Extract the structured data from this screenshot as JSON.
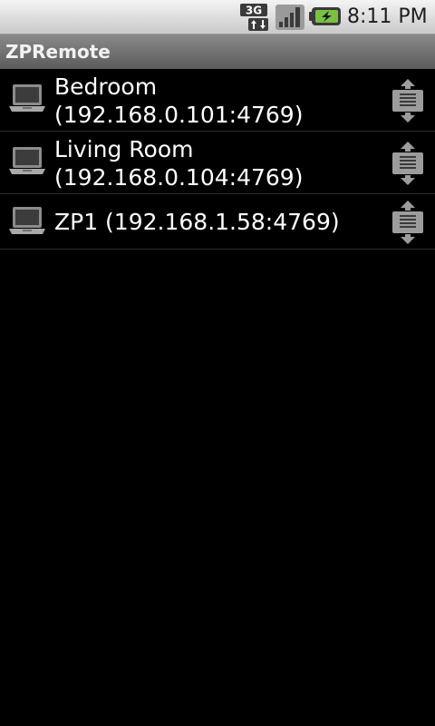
{
  "status_bar": {
    "network_label": "3G",
    "network_icon": "3g-data-icon",
    "signal_icon": "signal-strength-icon",
    "battery_icon": "battery-charging-icon",
    "time": "8:11 PM"
  },
  "app": {
    "title": "ZPRemote"
  },
  "devices": [
    {
      "name": "Bedroom",
      "address": "(192.168.0.101:4769)"
    },
    {
      "name": "Living Room",
      "address": "(192.168.0.104:4769)"
    },
    {
      "label": "ZP1 (192.168.1.58:4769)"
    }
  ],
  "colors": {
    "background": "#000000",
    "text": "#ffffff",
    "title_bar": "#6e6e6e",
    "status_bar": "#dcdcdc",
    "battery_accent": "#7ac142"
  }
}
